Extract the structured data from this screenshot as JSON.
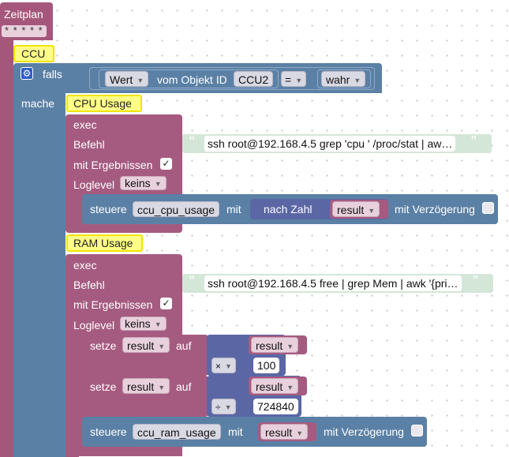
{
  "schedule": {
    "label": "Zeitplan",
    "cron": "* * * * *"
  },
  "ccu_block": {
    "label": "CCU",
    "if_label": "falls",
    "do_label": "mache",
    "gear_icon": "gear-icon",
    "condition": {
      "value_dropdown": "Wert",
      "of_object_label": "vom Objekt ID",
      "object_id": "CCU2",
      "operator": "=",
      "compare_value": "wahr"
    }
  },
  "cpu_block": {
    "comment": "CPU Usage",
    "exec_label": "exec",
    "command_label": "Befehl",
    "command": "ssh root@192.168.4.5 grep 'cpu ' /proc/stat | aw…",
    "with_results_label": "mit Ergebnissen",
    "with_results_checked": true,
    "loglevel_label": "Loglevel",
    "loglevel": "keins",
    "control": {
      "label": "steuere",
      "variable": "ccu_cpu_usage",
      "with_label": "mit",
      "to_number_label": "nach Zahl",
      "value": "result",
      "delay_label": "mit Verzögerung"
    }
  },
  "ram_block": {
    "comment": "RAM Usage",
    "exec_label": "exec",
    "command_label": "Befehl",
    "command": "ssh root@192.168.4.5 free | grep Mem | awk '{pri…",
    "with_results_label": "mit Ergebnissen",
    "with_results_checked": true,
    "loglevel_label": "Loglevel",
    "loglevel": "keins",
    "set1": {
      "label": "setze",
      "variable": "result",
      "to_label": "auf",
      "operand_var": "result",
      "operator": "×",
      "number": "100"
    },
    "set2": {
      "label": "setze",
      "variable": "result",
      "to_label": "auf",
      "operand_var": "result",
      "operator": "÷",
      "number": "724840"
    },
    "control": {
      "label": "steuere",
      "variable": "ccu_ram_usage",
      "with_label": "mit",
      "value": "result",
      "delay_label": "mit Verzögerung"
    }
  },
  "colors": {
    "event_block": "#a5577b",
    "logic_block": "#5b80a5",
    "exec_block": "#a55b80",
    "text_block": "#d4e6d8",
    "math_block": "#5b67a5",
    "comment": "#ffff88"
  }
}
